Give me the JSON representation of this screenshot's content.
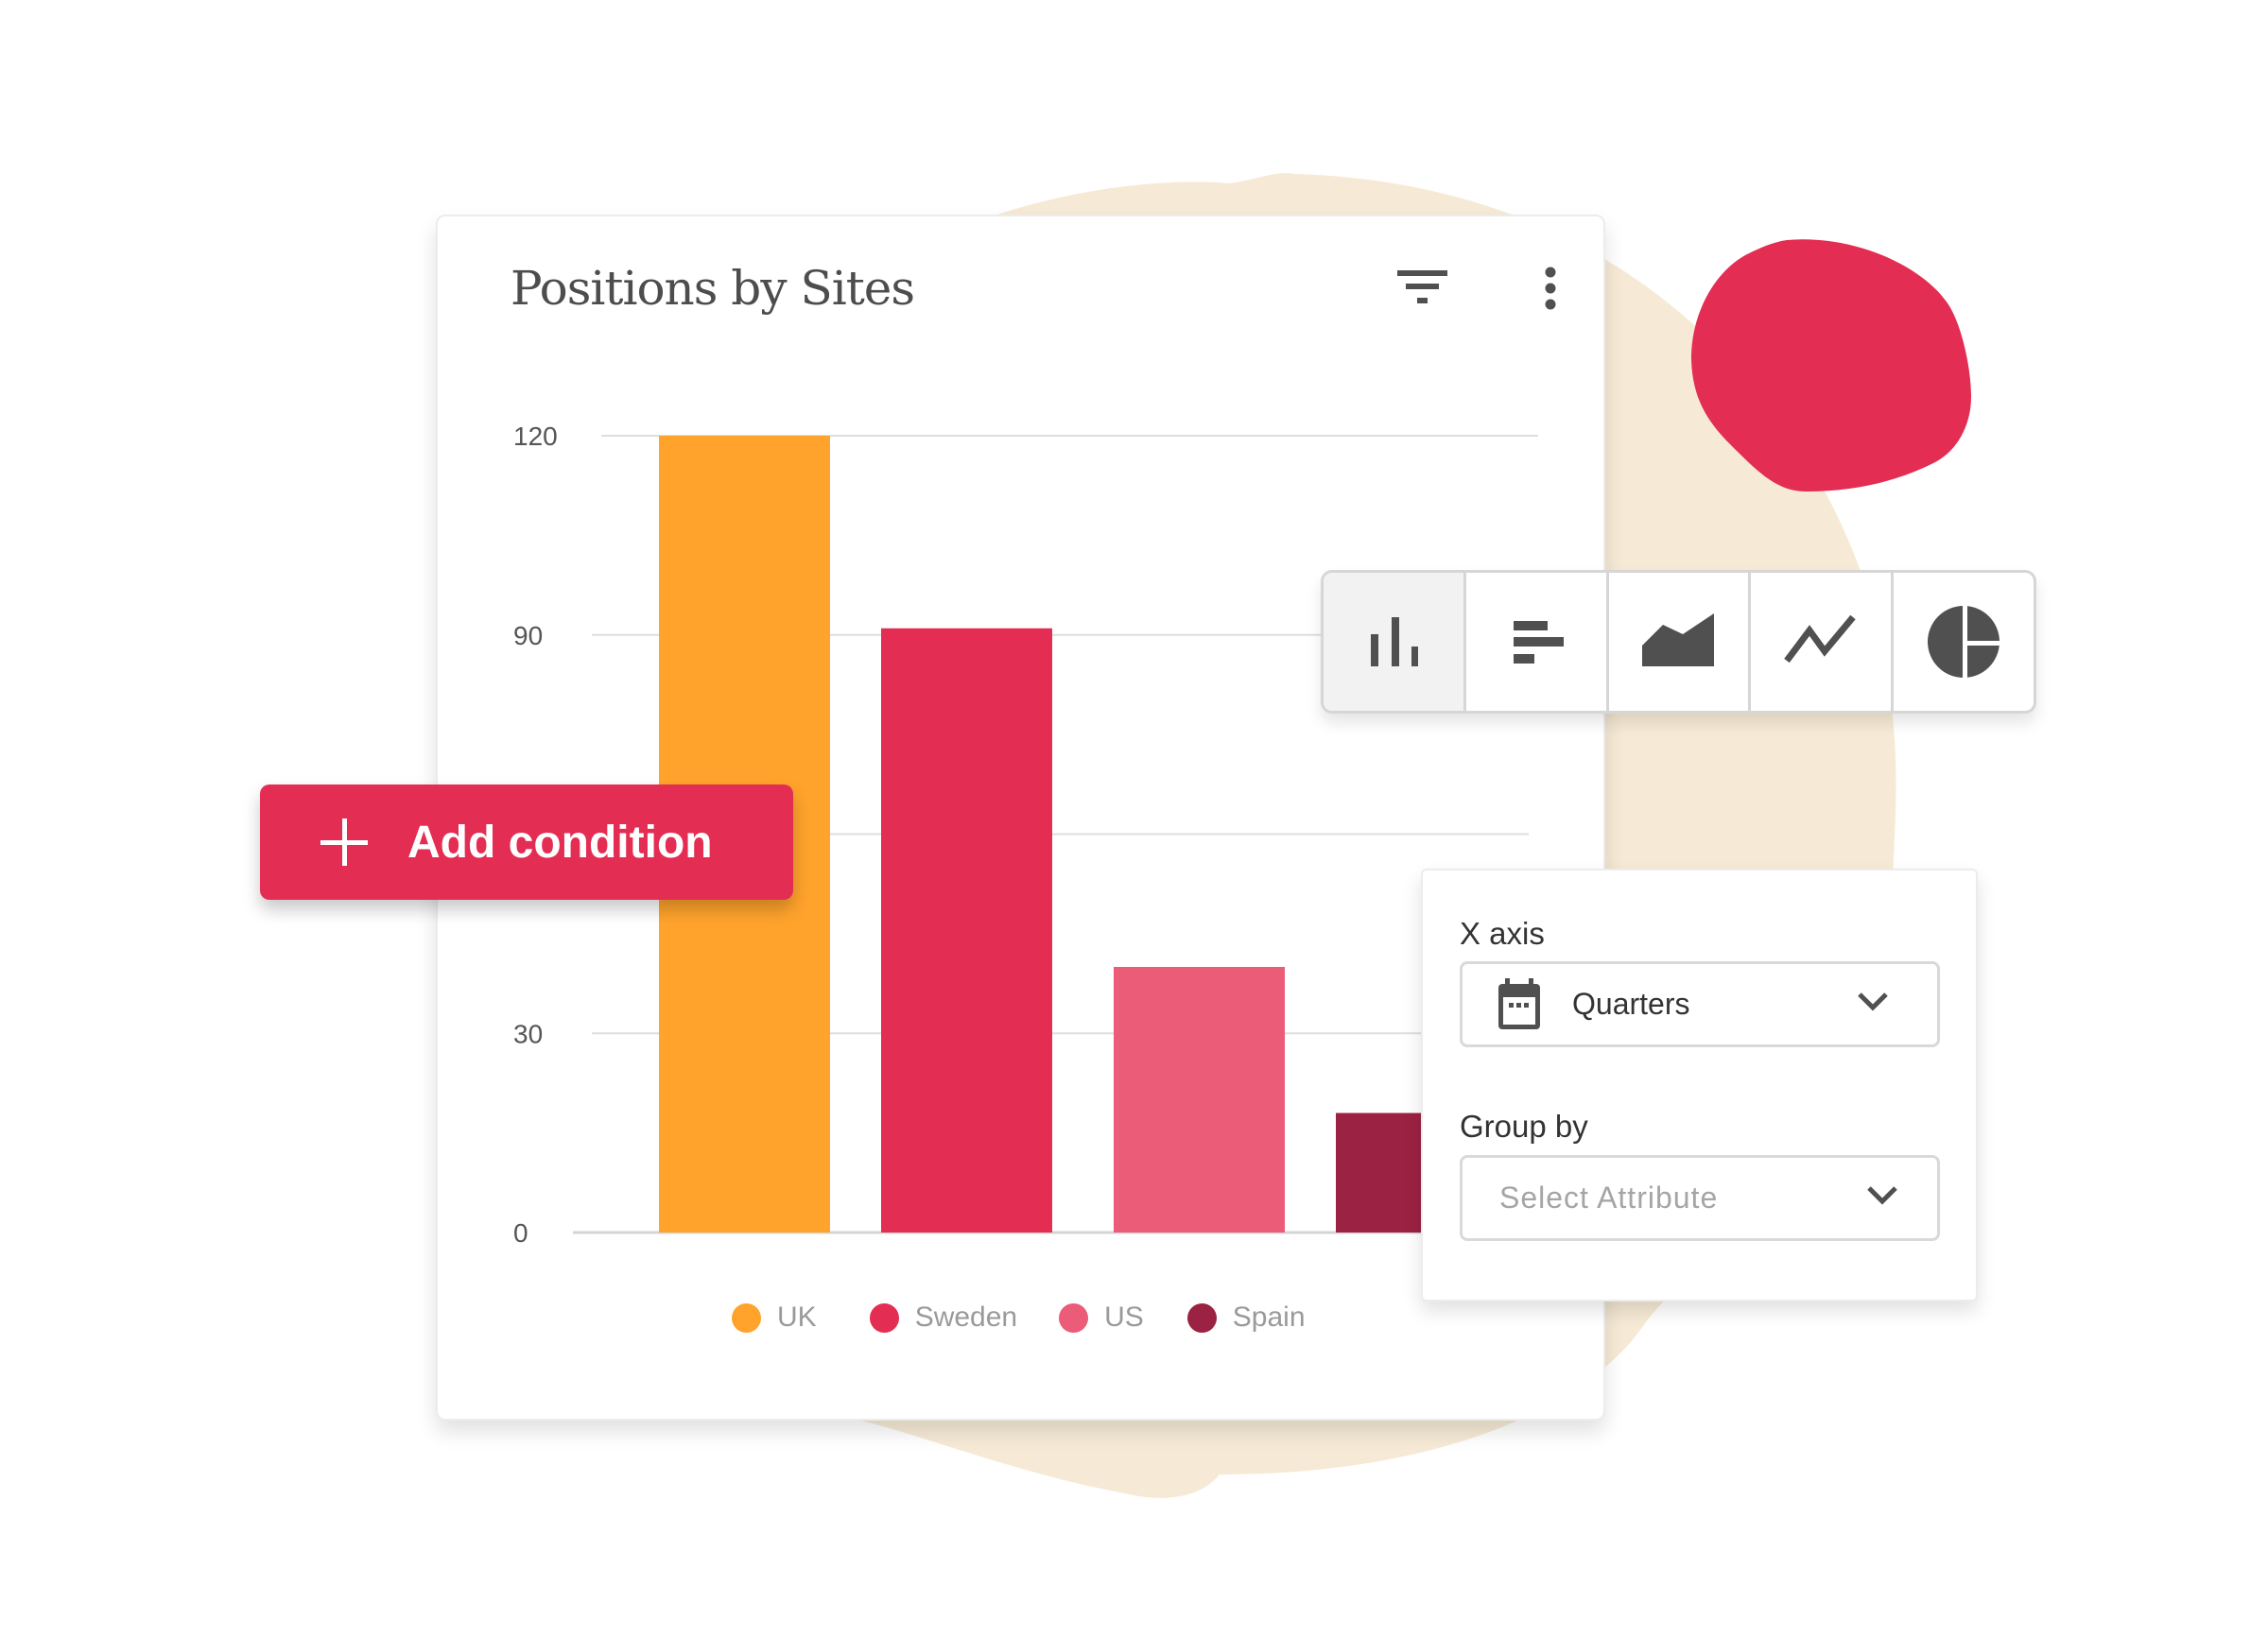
{
  "card": {
    "title": "Positions by Sites",
    "filter_icon": "filter-icon",
    "more_icon": "more-vertical-icon"
  },
  "chart_data": {
    "type": "bar",
    "title": "Positions by Sites",
    "categories": [
      "UK",
      "Sweden",
      "US",
      "Spain"
    ],
    "values": [
      120,
      91,
      40,
      18
    ],
    "colors": [
      "#ffa32c",
      "#e42d53",
      "#ea5c78",
      "#9c2243"
    ],
    "xlabel": "",
    "ylabel": "",
    "ylim": [
      0,
      120
    ],
    "yticks": [
      0,
      30,
      60,
      90,
      120
    ],
    "ytick_labels": [
      "0",
      "30",
      "",
      "90",
      "120"
    ],
    "grid": true,
    "legend": "bottom"
  },
  "legend": [
    {
      "label": "UK",
      "color": "#ffa32c"
    },
    {
      "label": "Sweden",
      "color": "#e42d53"
    },
    {
      "label": "US",
      "color": "#ea5c78"
    },
    {
      "label": "Spain",
      "color": "#9c2243"
    }
  ],
  "add_condition": {
    "label": "Add condition",
    "icon": "plus-icon"
  },
  "chart_types": [
    {
      "name": "column-chart",
      "icon": "column-chart-icon",
      "active": true
    },
    {
      "name": "horizontal-bar-chart",
      "icon": "horizontal-bar-chart-icon",
      "active": false
    },
    {
      "name": "area-chart",
      "icon": "area-chart-icon",
      "active": false
    },
    {
      "name": "line-chart",
      "icon": "line-chart-icon",
      "active": false
    },
    {
      "name": "pie-chart",
      "icon": "pie-chart-icon",
      "active": false
    }
  ],
  "settings": {
    "x_axis": {
      "label": "X axis",
      "value": "Quarters",
      "icon": "calendar-icon"
    },
    "group_by": {
      "label": "Group by",
      "placeholder": "Select Attribute"
    }
  },
  "colors": {
    "accent": "#e42d53",
    "beige": "#f6ead6",
    "icon": "#505050"
  }
}
